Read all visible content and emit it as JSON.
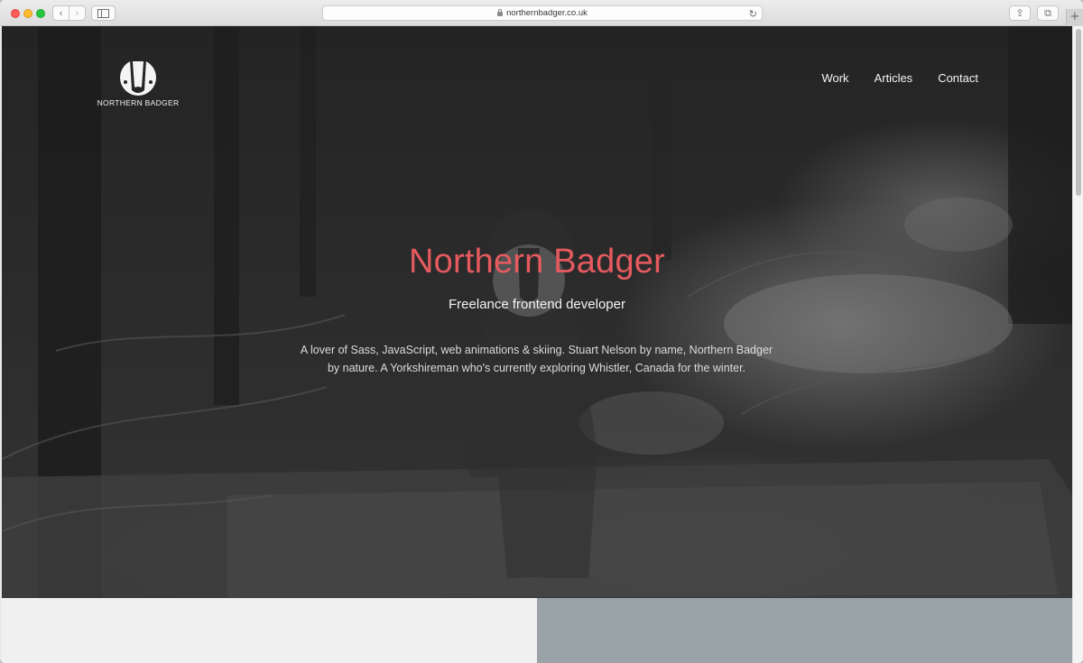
{
  "browser": {
    "url": "northernbadger.co.uk",
    "icons": {
      "back": "chevron-left-icon",
      "forward": "chevron-right-icon",
      "sidebar": "sidebar-icon",
      "reload": "reload-icon",
      "share": "share-icon",
      "tabs": "tabs-icon",
      "new_tab": "plus-icon"
    },
    "glyphs": {
      "back": "‹",
      "forward": "›",
      "reload": "↻",
      "share": "⇪",
      "tabs": "⧉",
      "new_tab": "+"
    }
  },
  "site": {
    "logo_text": "NORTHERN BADGER",
    "nav": [
      {
        "label": "Work"
      },
      {
        "label": "Articles"
      },
      {
        "label": "Contact"
      }
    ],
    "hero": {
      "title": "Northern Badger",
      "subtitle": "Freelance frontend developer",
      "body": "A lover of Sass, JavaScript, web animations & skiing. Stuart Nelson by name, Northern Badger by nature. A Yorkshireman who's currently exploring Whistler, Canada for the winter."
    },
    "colors": {
      "accent": "#e55a5e",
      "panel_left": "#eff0ef",
      "panel_right": "#9aa3a8"
    }
  }
}
